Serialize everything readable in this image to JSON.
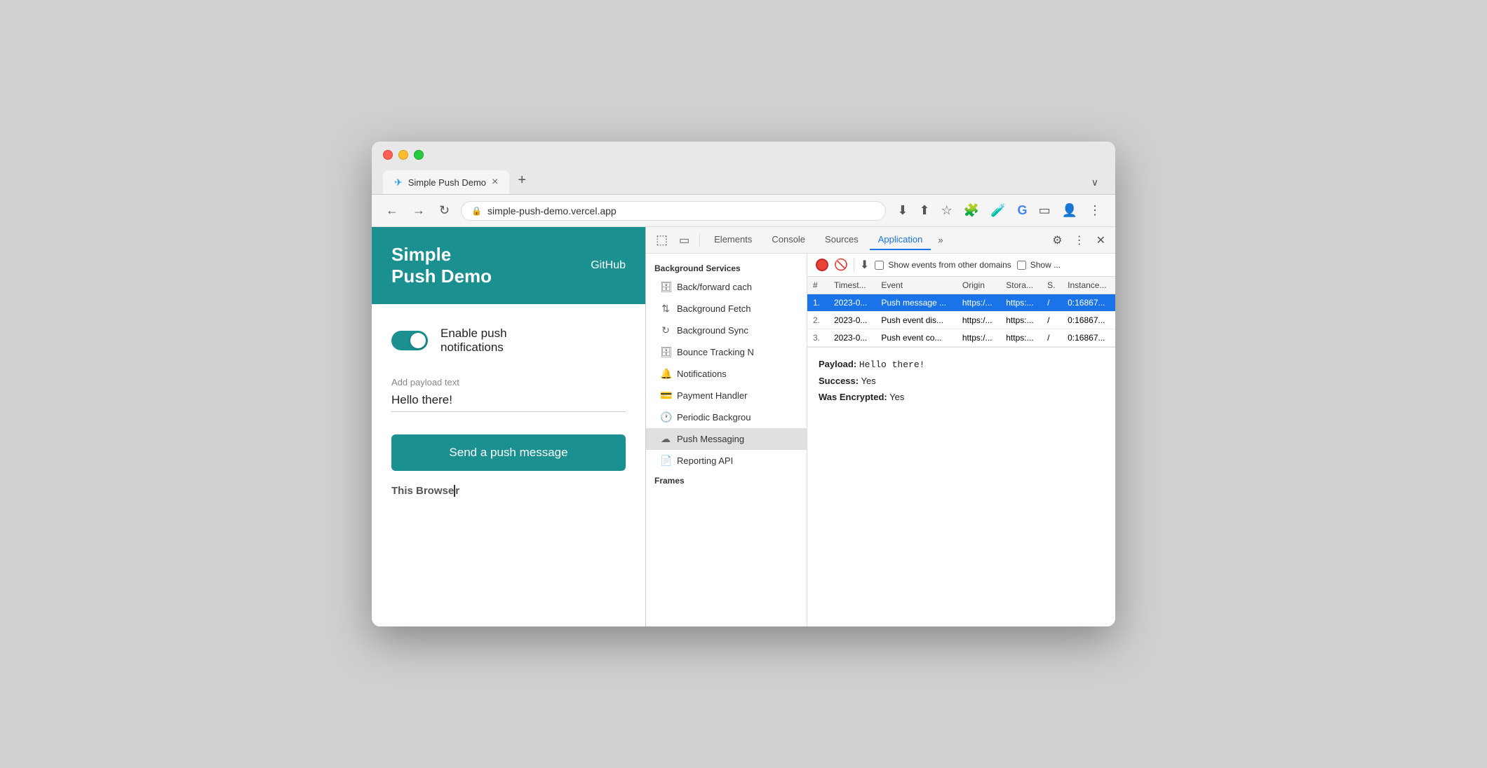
{
  "browser": {
    "tab_title": "Simple Push Demo",
    "tab_close": "×",
    "tab_new": "+",
    "tab_expand": "∨",
    "url": "simple-push-demo.vercel.app",
    "lock_icon": "🔒"
  },
  "nav": {
    "back": "←",
    "forward": "→",
    "reload": "↻"
  },
  "nav_actions": {
    "download": "⬇",
    "share": "⬆",
    "bookmark": "☆",
    "extensions": "🧩",
    "lab": "🧪",
    "google": "G",
    "splitscreen": "▭",
    "profile": "👤",
    "menu": "⋮"
  },
  "webpage": {
    "site_title": "Simple\nPush Demo",
    "github_label": "GitHub",
    "toggle_label": "Enable push\nnotifications",
    "payload_label": "Add payload text",
    "payload_value": "Hello there!",
    "send_button": "Send a push message",
    "this_browser": "This Browser"
  },
  "devtools": {
    "tabs": [
      {
        "label": "Elements",
        "active": false
      },
      {
        "label": "Console",
        "active": false
      },
      {
        "label": "Sources",
        "active": false
      },
      {
        "label": "Application",
        "active": true
      }
    ],
    "more_tabs": "»",
    "actions": {
      "settings": "⚙",
      "more": "⋮",
      "close": "×"
    },
    "sidebar": {
      "section_label": "Background Services",
      "items": [
        {
          "icon": "🗄",
          "label": "Back/forward cach"
        },
        {
          "icon": "↑↓",
          "label": "Background Fetch"
        },
        {
          "icon": "↻",
          "label": "Background Sync"
        },
        {
          "icon": "🗄",
          "label": "Bounce Tracking N"
        },
        {
          "icon": "🔔",
          "label": "Notifications"
        },
        {
          "icon": "💳",
          "label": "Payment Handler"
        },
        {
          "icon": "🕐",
          "label": "Periodic Backgrou"
        },
        {
          "icon": "☁",
          "label": "Push Messaging",
          "active": true
        },
        {
          "icon": "📄",
          "label": "Reporting API"
        }
      ],
      "frames_label": "Frames"
    },
    "main_toolbar": {
      "record_label": "Record",
      "clear_label": "🚫",
      "download_label": "⬇",
      "checkbox_label": "Show events from other domains",
      "checkbox2_label": "Show ..."
    },
    "table": {
      "columns": [
        "#",
        "Timest...",
        "Event",
        "Origin",
        "Stora...",
        "S.",
        "Instance..."
      ],
      "rows": [
        {
          "num": "1.",
          "timestamp": "2023-0...",
          "event": "Push message ...",
          "origin": "https:/...",
          "storage": "https:...",
          "s": "/",
          "instance": "0:16867...",
          "selected": true
        },
        {
          "num": "2.",
          "timestamp": "2023-0...",
          "event": "Push event dis...",
          "origin": "https:/...",
          "storage": "https:...",
          "s": "/",
          "instance": "0:16867...",
          "selected": false
        },
        {
          "num": "3.",
          "timestamp": "2023-0...",
          "event": "Push event co...",
          "origin": "https:/...",
          "storage": "https:...",
          "s": "/",
          "instance": "0:16867...",
          "selected": false
        }
      ]
    },
    "detail": {
      "payload_key": "Payload:",
      "payload_value": "Hello there!",
      "success_key": "Success:",
      "success_value": "Yes",
      "encrypted_key": "Was Encrypted:",
      "encrypted_value": "Yes"
    }
  }
}
